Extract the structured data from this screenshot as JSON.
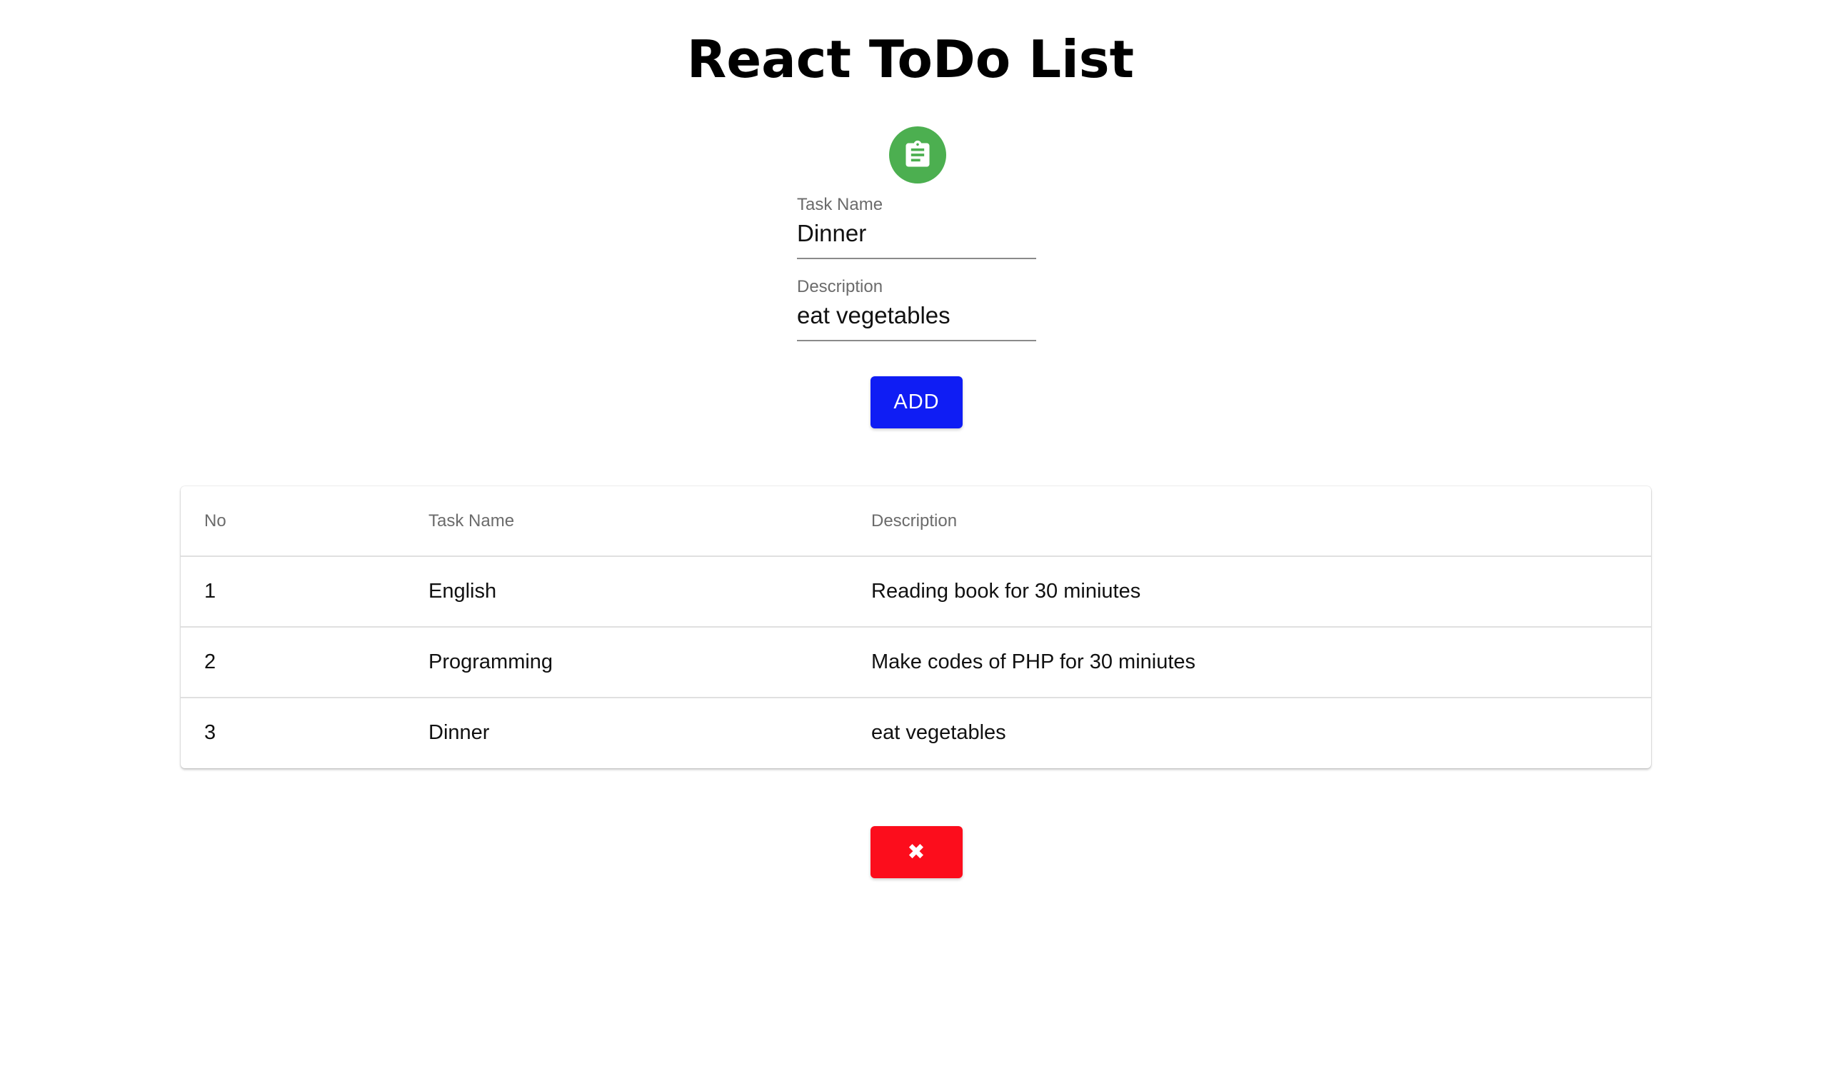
{
  "page": {
    "title": "React ToDo List"
  },
  "header_icon": {
    "icon": "assignment-clipboard-icon",
    "color": "#4caf50"
  },
  "form": {
    "task_name": {
      "label": "Task Name",
      "value": "Dinner"
    },
    "description": {
      "label": "Description",
      "value": "eat vegetables"
    },
    "add_button": {
      "label": "ADD",
      "color": "#0f1df4"
    }
  },
  "table": {
    "columns": [
      "No",
      "Task Name",
      "Description"
    ],
    "rows": [
      {
        "no": "1",
        "task_name": "English",
        "description": "Reading book for 30 miniutes"
      },
      {
        "no": "2",
        "task_name": "Programming",
        "description": "Make codes of PHP for 30 miniutes"
      },
      {
        "no": "3",
        "task_name": "Dinner",
        "description": "eat vegetables"
      }
    ]
  },
  "clear_button": {
    "label": "✖",
    "icon": "close-icon",
    "color": "#fc0d1c"
  }
}
